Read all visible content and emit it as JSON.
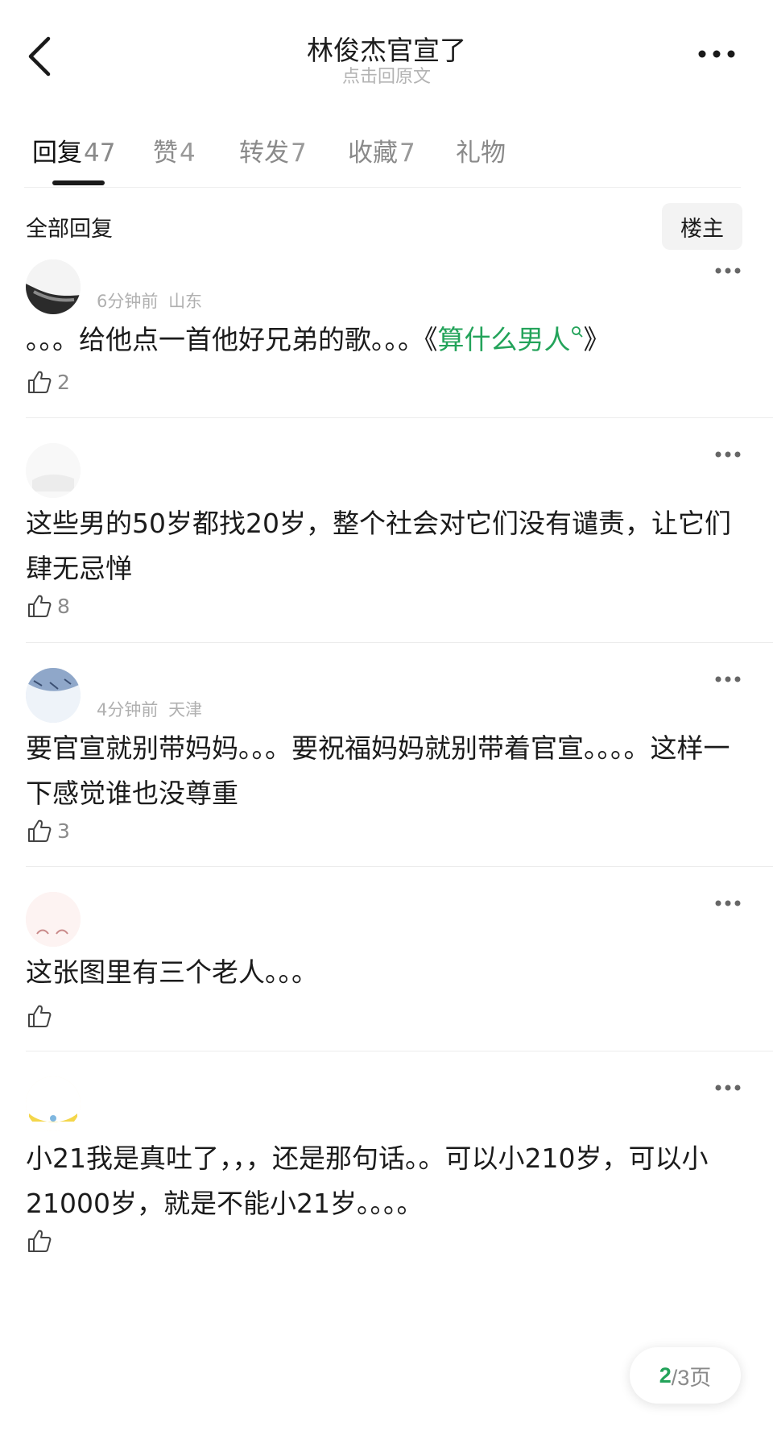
{
  "header": {
    "title": "林俊杰官宣了",
    "subtitle": "点击回原文"
  },
  "tabs": [
    {
      "label": "回复",
      "count": "47"
    },
    {
      "label": "赞",
      "count": "4"
    },
    {
      "label": "转发",
      "count": "7"
    },
    {
      "label": "收藏",
      "count": "7"
    },
    {
      "label": "礼物",
      "count": ""
    }
  ],
  "filter": {
    "label": "全部回复",
    "op_button": "楼主"
  },
  "comments": [
    {
      "time": "6分钟前",
      "location": "山东",
      "text_before": "。。。给他点一首他好兄弟的歌。。。《",
      "link": "算什么男人",
      "text_after": "》",
      "likes": "2"
    },
    {
      "time": "",
      "location": "",
      "text": "这些男的50岁都找20岁，整个社会对它们没有谴责，让它们肆无忌惮",
      "likes": "8"
    },
    {
      "time": "4分钟前",
      "location": "天津",
      "text": "要官宣就别带妈妈。。。要祝福妈妈就别带着官宣。。。。这样一下感觉谁也没尊重",
      "likes": "3"
    },
    {
      "time": "",
      "location": "",
      "text": "这张图里有三个老人。。。",
      "likes": ""
    },
    {
      "time": "",
      "location": "",
      "text": "小21我是真吐了，，，还是那句话。。可以小210岁，可以小21000岁，就是不能小21岁。。。。",
      "likes": ""
    }
  ],
  "pager": {
    "current": "2",
    "total": "/3页"
  },
  "colors": {
    "accent": "#23a35a",
    "text": "#1b1b1b",
    "muted": "#8a8a8a"
  }
}
